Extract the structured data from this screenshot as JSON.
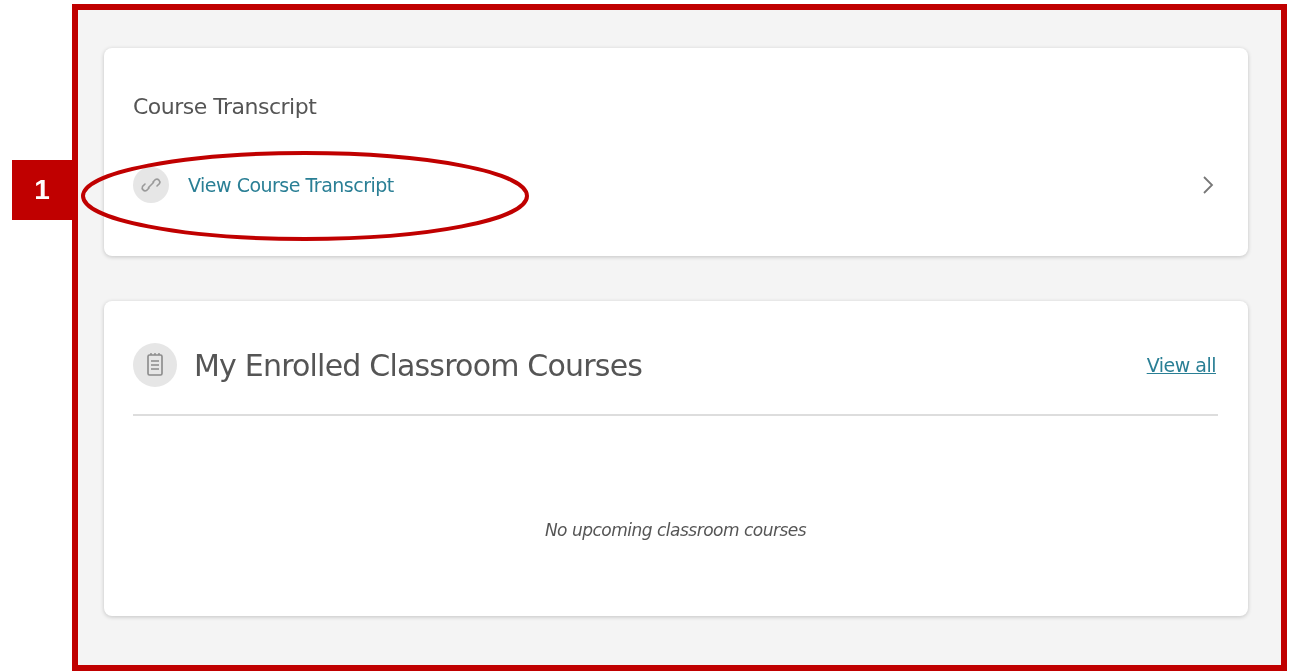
{
  "annotation": {
    "number": "1"
  },
  "transcript_card": {
    "title": "Course Transcript",
    "link": "View Course Transcript"
  },
  "classroom_card": {
    "title": "My Enrolled Classroom Courses",
    "view_all": "View all",
    "empty_message": "No upcoming classroom courses"
  }
}
